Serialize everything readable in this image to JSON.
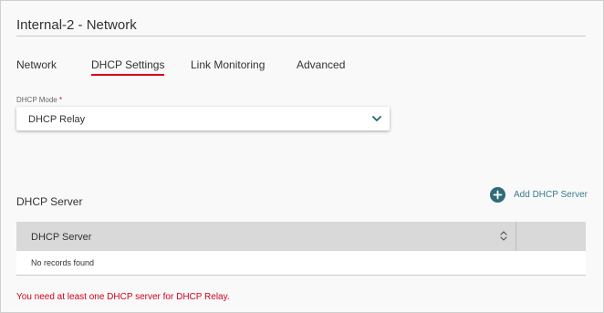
{
  "page": {
    "title": "Internal-2 - Network"
  },
  "tabs": [
    {
      "label": "Network",
      "active": false
    },
    {
      "label": "DHCP Settings",
      "active": true
    },
    {
      "label": "Link Monitoring",
      "active": false
    },
    {
      "label": "Advanced",
      "active": false
    }
  ],
  "dhcp_mode": {
    "label": "DHCP Mode",
    "required_marker": "*",
    "value": "DHCP Relay",
    "icon": "chevron-down-icon"
  },
  "dhcp_server_section": {
    "title": "DHCP Server",
    "add_button": {
      "label": "Add DHCP Server",
      "icon": "plus-circle-icon"
    },
    "table": {
      "columns": [
        {
          "label": "DHCP Server",
          "icon": "sort-icon"
        }
      ],
      "empty_text": "No records found"
    },
    "error_message": "You need at least one DHCP server for DHCP Relay."
  },
  "colors": {
    "accent_red": "#d0021b",
    "accent_teal": "#3a7d8c",
    "table_header": "#d9d9d9"
  }
}
